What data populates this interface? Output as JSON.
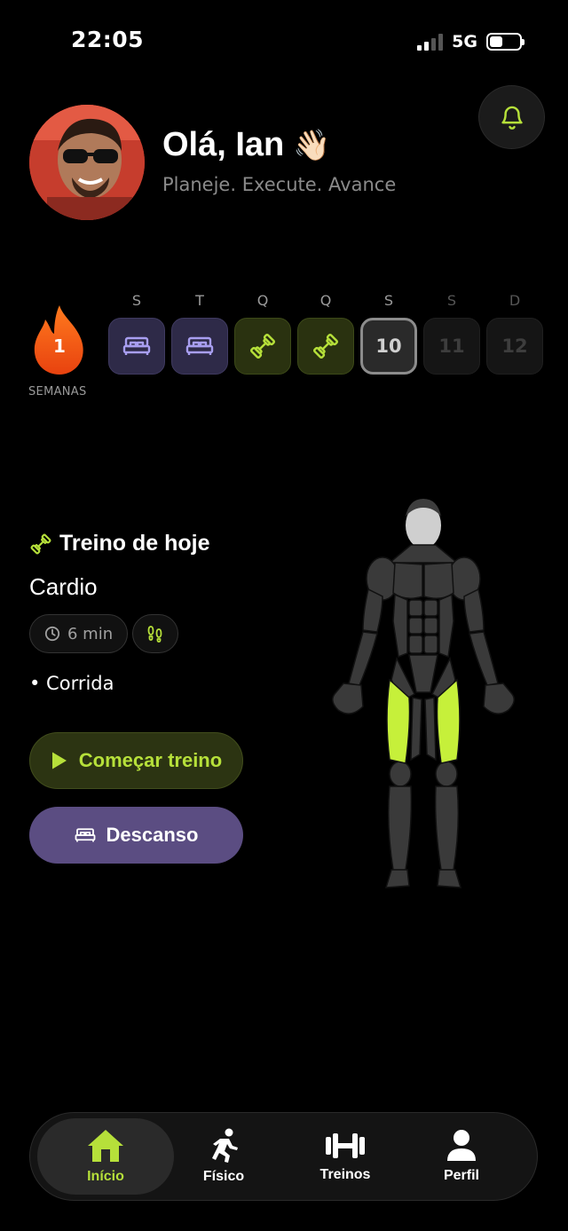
{
  "status": {
    "time": "22:05",
    "network": "5G"
  },
  "header": {
    "greeting": "Olá, Ian",
    "wave_emoji": "👋🏻",
    "subtitle": "Planeje. Execute. Avance"
  },
  "streak": {
    "count": "1",
    "label": "SEMANAS"
  },
  "week": [
    {
      "letter": "S",
      "state": "rest",
      "icon": "bed-icon"
    },
    {
      "letter": "T",
      "state": "rest",
      "icon": "bed-icon"
    },
    {
      "letter": "Q",
      "state": "trained",
      "icon": "dumbbell-icon"
    },
    {
      "letter": "Q",
      "state": "trained",
      "icon": "dumbbell-icon"
    },
    {
      "letter": "S",
      "state": "today",
      "number": "10"
    },
    {
      "letter": "S",
      "state": "future",
      "number": "11"
    },
    {
      "letter": "D",
      "state": "future",
      "number": "12"
    }
  ],
  "today_workout": {
    "title": "Treino de hoje",
    "name": "Cardio",
    "duration": "6 min",
    "exercises": [
      "• Corrida"
    ],
    "start_label": "Começar treino",
    "rest_label": "Descanso"
  },
  "nav": [
    {
      "label": "Início",
      "icon": "home-icon",
      "active": true
    },
    {
      "label": "Físico",
      "icon": "running-icon",
      "active": false
    },
    {
      "label": "Treinos",
      "icon": "dumbbell-icon",
      "active": false
    },
    {
      "label": "Perfil",
      "icon": "user-icon",
      "active": false
    }
  ],
  "colors": {
    "accent_green": "#b6e03a",
    "rest_purple": "#5b4d82",
    "bed_icon": "#a89ef0",
    "flame_orange": "#f4551a"
  }
}
